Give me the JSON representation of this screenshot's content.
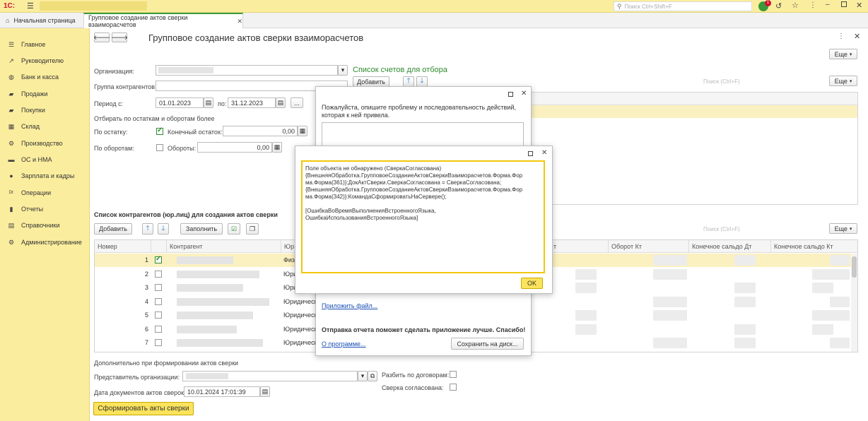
{
  "app": {
    "logo": "1С:",
    "search_placeholder": "Поиск Ctrl+Shift+F",
    "notification_count": "1"
  },
  "tabs": {
    "home": "Начальная страница",
    "current": "Групповое создание актов сверки взаиморасчетов"
  },
  "sidebar": {
    "items": [
      {
        "label": "Главное",
        "icon": "☰"
      },
      {
        "label": "Руководителю",
        "icon": "↗"
      },
      {
        "label": "Банк и касса",
        "icon": "◍"
      },
      {
        "label": "Продажи",
        "icon": "▰"
      },
      {
        "label": "Покупки",
        "icon": "▰"
      },
      {
        "label": "Склад",
        "icon": "▦"
      },
      {
        "label": "Производство",
        "icon": "⚙"
      },
      {
        "label": "ОС и НМА",
        "icon": "▬"
      },
      {
        "label": "Зарплата и кадры",
        "icon": "●"
      },
      {
        "label": "Операции",
        "icon": "ᴰᵗ"
      },
      {
        "label": "Отчеты",
        "icon": "▮"
      },
      {
        "label": "Справочники",
        "icon": "▤"
      },
      {
        "label": "Администрирование",
        "icon": "⚙"
      }
    ]
  },
  "form": {
    "title": "Групповое создание актов сверки взаиморасчетов",
    "more_label": "Еще",
    "more_arrow": "▾",
    "org_label": "Организация:",
    "group_label": "Группа контрагентов:",
    "period_label": "Период с:",
    "date_from": "01.01.2023",
    "to_label": "по:",
    "date_to": "31.12.2023",
    "ellipsis": "...",
    "filter_heading": "Отбирать по остаткам и оборотам более",
    "balance_label": "По остатку:",
    "final_balance_label": "Конечный остаток:",
    "final_balance_value": "0,00",
    "turnover_label": "По оборотам:",
    "turnover_field_label": "Обороты:",
    "turnover_value": "0,00",
    "accounts_title": "Список счетов для отбора",
    "add_label": "Добавить",
    "search_placeholder": "Поиск (Ctrl+F)",
    "contractors_title": "Список контрагентов  (юр.лиц)  для создания актов сверки",
    "fill_label": "Заполнить",
    "columns": {
      "num": "Номер",
      "contractor": "Контрагент",
      "type": "Юр",
      "col_t": "т",
      "turnover_kt": "Оборот Кт",
      "end_dt": "Конечное сальдо Дт",
      "end_kt": "Конечное сальдо Кт"
    },
    "rows": [
      {
        "num": "1",
        "type": "Физ",
        "checked": true
      },
      {
        "num": "2",
        "type": "Юри",
        "checked": false
      },
      {
        "num": "3",
        "type": "Юри",
        "checked": false
      },
      {
        "num": "4",
        "type": "Юридическ",
        "checked": false
      },
      {
        "num": "5",
        "type": "Юридическ",
        "checked": false
      },
      {
        "num": "6",
        "type": "Юридическ",
        "checked": false
      },
      {
        "num": "7",
        "type": "Юридическ",
        "checked": false
      }
    ],
    "additional_label": "Дополнительно при формировании актов сверки",
    "representative_label": "Представитель организации:",
    "split_label": "Разбить по договорам:",
    "doc_date_label": "Дата документов актов сверок:",
    "doc_date_value": "10.01.2024 17:01:39",
    "agreed_label": "Сверка согласована:",
    "generate_label": "Сформировать акты сверки"
  },
  "report_dialog": {
    "prompt": "Пожалуйста, опишите проблему и последовательность действий, которая к ней привела.",
    "attach_link": "Приложить файл...",
    "thanks": "Отправка отчета поможет сделать приложение лучше. Спасибо!",
    "about_link": "О программе...",
    "save_button": "Сохранить на диск..."
  },
  "error_dialog": {
    "lines": [
      "Поле объекта не обнаружено (СверкаСогласована)",
      "{ВнешняяОбработка.ГрупповоеСозданиеАктовСверкиВзаиморасчетов.Форма.Фор",
      "ма.Форма(361)}:ДокАктСверки.СверкаСогласована = СверкаСогласована;",
      "{ВнешняяОбработка.ГрупповоеСозданиеАктовСверкиВзаиморасчетов.Форма.Фор",
      "ма.Форма(342)}:КомандаСформироватьНаСервере();",
      "",
      "[ОшибкаВоВремяВыполненияВстроенногоЯзыка,",
      "ОшибкаИспользованияВстроенногоЯзыка]"
    ],
    "ok_label": "OK"
  }
}
